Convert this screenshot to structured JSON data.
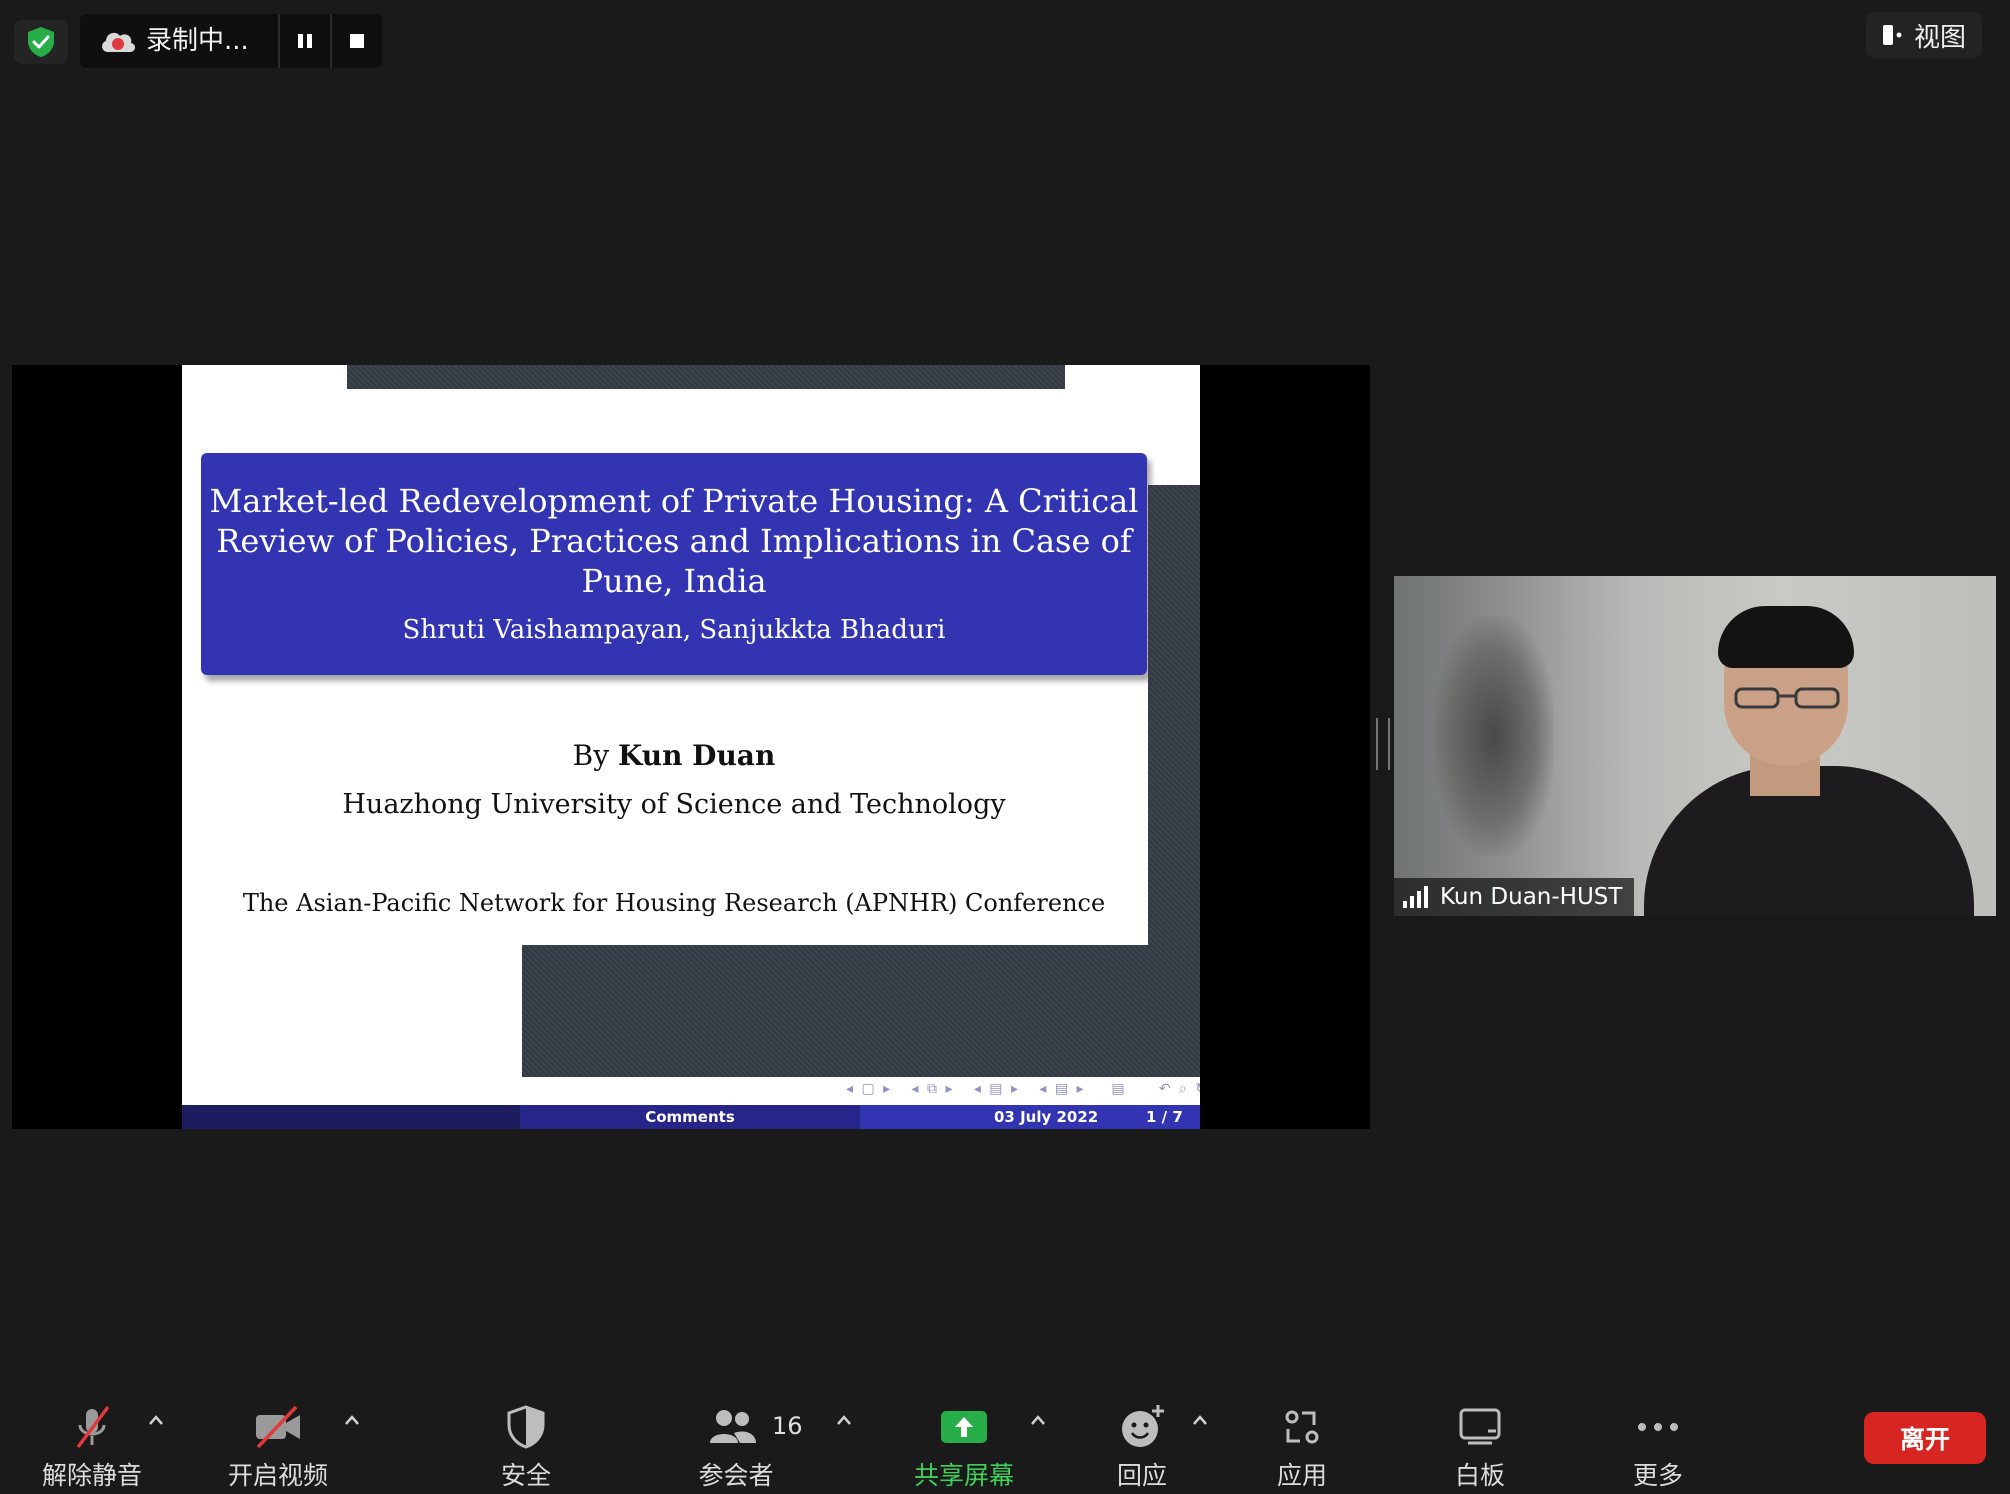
{
  "top_bar": {
    "recording_status": "录制中...",
    "view_label": "视图"
  },
  "slide": {
    "title": "Market-led Redevelopment of Private Housing: A Critical Review of Policies, Practices and Implications in Case of Pune, India",
    "authors": "Shruti Vaishampayan, Sanjukkta Bhaduri",
    "by_prefix": "By",
    "presenter": "Kun Duan",
    "institution": "Huazhong University of Science and Technology",
    "conference": "The Asian-Pacific Network for Housing Research (APNHR) Conference",
    "footer_center": "Comments",
    "footer_date": "03 July 2022",
    "footer_page": "1 / 7"
  },
  "participant": {
    "name": "Kun Duan-HUST"
  },
  "toolbar": {
    "unmute": "解除静音",
    "start_video": "开启视频",
    "security": "安全",
    "participants": "参会者",
    "participant_count": "16",
    "share_screen": "共享屏幕",
    "reactions": "回应",
    "apps": "应用",
    "whiteboard": "白板",
    "more": "更多",
    "leave": "离开"
  },
  "colors": {
    "background": "#1a1a1a",
    "slide_title_box": "#3334b2",
    "share_green": "#3fcf5a",
    "leave_red": "#d72622",
    "security_green": "#27ae48"
  }
}
